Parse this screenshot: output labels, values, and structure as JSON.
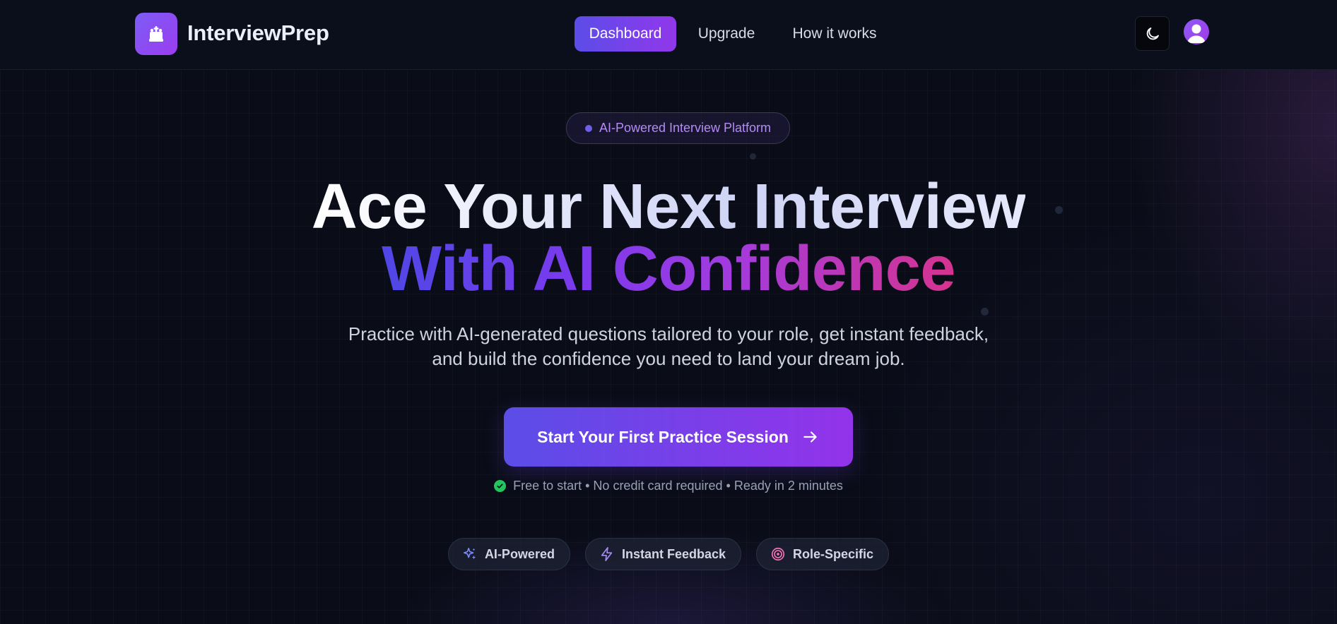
{
  "header": {
    "brand": "InterviewPrep",
    "nav": [
      {
        "label": "Dashboard",
        "active": true
      },
      {
        "label": "Upgrade",
        "active": false
      },
      {
        "label": "How it works",
        "active": false
      }
    ],
    "theme_toggle_icon": "moon-icon",
    "avatar_icon": "user-icon"
  },
  "hero": {
    "badge": "AI-Powered Interview Platform",
    "headline_line1": "Ace Your Next Interview",
    "headline_line2": "With AI Confidence",
    "subtitle_line1": "Practice with AI-generated questions tailored to your role, get instant feedback,",
    "subtitle_line2": "and build the confidence you need to land your dream job.",
    "cta_label": "Start Your First Practice Session",
    "note": "Free to start • No credit card required • Ready in 2 minutes"
  },
  "features": [
    {
      "label": "AI-Powered",
      "icon": "sparkles-icon",
      "color": "#818cf8"
    },
    {
      "label": "Instant Feedback",
      "icon": "lightning-icon",
      "color": "#a78bfa"
    },
    {
      "label": "Role-Specific",
      "icon": "target-icon",
      "color": "#f472b6"
    }
  ],
  "colors": {
    "background": "#0a0d18",
    "accent_start": "#5b4de8",
    "accent_end": "#9333ea",
    "success": "#22c55e"
  }
}
